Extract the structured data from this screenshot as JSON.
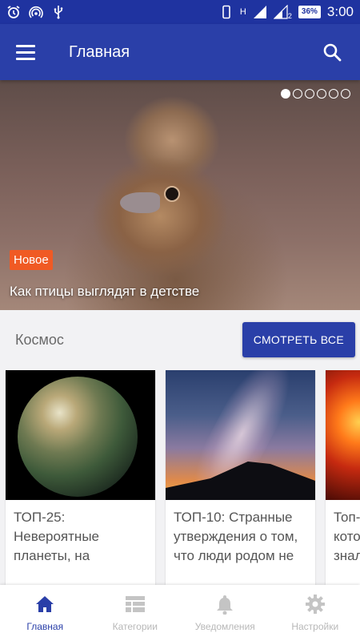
{
  "status_bar": {
    "time": "3:00",
    "battery": "36%",
    "network_label": "H",
    "network_sub": "2",
    "icons": [
      "alarm-icon",
      "hotspot-icon",
      "usb-icon",
      "vibrate-icon",
      "signal-icon",
      "signal-icon"
    ]
  },
  "toolbar": {
    "title": "Главная",
    "menu_icon": "hamburger-icon",
    "search_icon": "search-icon"
  },
  "hero": {
    "badge": "Новое",
    "caption": "Как птицы выглядят в детстве",
    "slide_count": 6,
    "active_slide": 1
  },
  "section": {
    "title": "Космос",
    "see_all": "СМОТРЕТЬ ВСЕ"
  },
  "cards": [
    {
      "text": "ТОП-25: Невероятные планеты, на"
    },
    {
      "text": "ТОП-10: Странные утверждения о том, что люди родом не"
    },
    {
      "text": "Топ-кото знал"
    }
  ],
  "bottom_nav": [
    {
      "label": "Главная",
      "icon": "home-icon",
      "active": true
    },
    {
      "label": "Категории",
      "icon": "categories-icon",
      "active": false
    },
    {
      "label": "Уведомления",
      "icon": "bell-icon",
      "active": false
    },
    {
      "label": "Настройки",
      "icon": "gear-icon",
      "active": false
    }
  ],
  "colors": {
    "primary": "#2a3fa8",
    "status_bar": "#1f33a0",
    "badge": "#f05a24",
    "inactive": "#b8b8b8"
  }
}
